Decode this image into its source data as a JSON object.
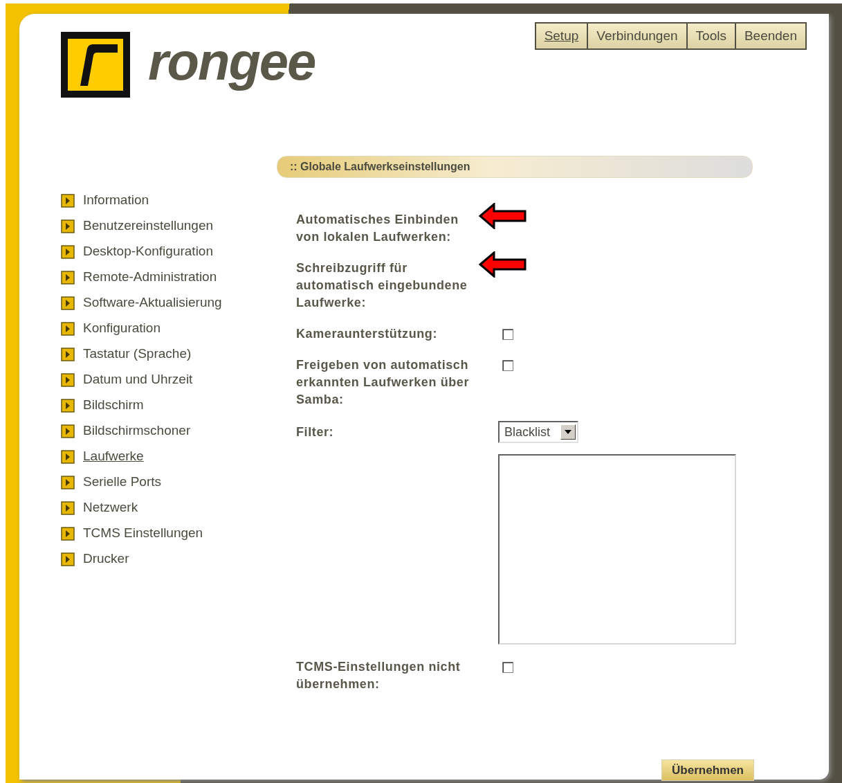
{
  "logo": {
    "text": "rongee"
  },
  "nav": [
    {
      "label": "Setup",
      "selected": true
    },
    {
      "label": "Verbindungen",
      "selected": false
    },
    {
      "label": "Tools",
      "selected": false
    },
    {
      "label": "Beenden",
      "selected": false
    }
  ],
  "sidebar": {
    "items": [
      {
        "label": "Information",
        "selected": false
      },
      {
        "label": "Benutzereinstellungen",
        "selected": false
      },
      {
        "label": "Desktop-Konfiguration",
        "selected": false
      },
      {
        "label": "Remote-Administration",
        "selected": false
      },
      {
        "label": "Software-Aktualisierung",
        "selected": false
      },
      {
        "label": "Konfiguration",
        "selected": false
      },
      {
        "label": "Tastatur (Sprache)",
        "selected": false
      },
      {
        "label": "Datum und Uhrzeit",
        "selected": false
      },
      {
        "label": "Bildschirm",
        "selected": false
      },
      {
        "label": "Bildschirmschoner",
        "selected": false
      },
      {
        "label": "Laufwerke",
        "selected": true
      },
      {
        "label": "Serielle Ports",
        "selected": false
      },
      {
        "label": "Netzwerk",
        "selected": false
      },
      {
        "label": "TCMS Einstellungen",
        "selected": false
      },
      {
        "label": "Drucker",
        "selected": false
      }
    ]
  },
  "section": {
    "title": ":: Globale Laufwerkseinstellungen"
  },
  "settings": [
    {
      "kind": "label",
      "label": "Automatisches Einbinden von lokalen Laufwerken:",
      "annotated": true
    },
    {
      "kind": "label",
      "label": "Schreibzugriff für automatisch eingebundene Laufwerke:",
      "annotated": true
    },
    {
      "kind": "checkbox",
      "label": "Kameraunterstützung:",
      "checked": false
    },
    {
      "kind": "checkbox",
      "label": "Freigeben von automatisch erkannten Laufwerken über Samba:",
      "checked": false
    },
    {
      "kind": "select",
      "label": "Filter:",
      "value": "Blacklist"
    },
    {
      "kind": "listbox"
    },
    {
      "kind": "checkbox",
      "label": "TCMS-Einstellungen nicht übernehmen:",
      "checked": false
    }
  ],
  "apply_button": {
    "label": "Übernehmen"
  }
}
